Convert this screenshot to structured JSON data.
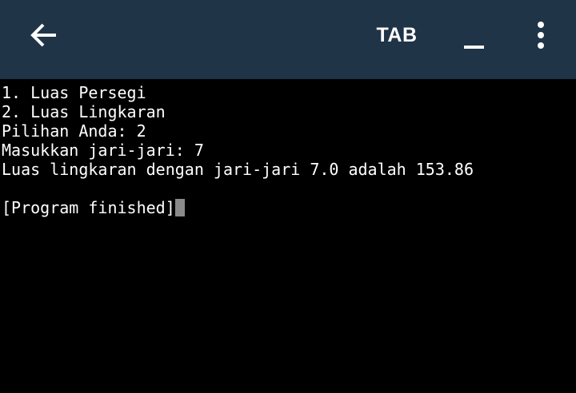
{
  "toolbar": {
    "back_icon": "arrow-left-icon",
    "tab_label": "TAB",
    "minimize_icon": "underscore-icon",
    "menu_icon": "more-vertical-icon",
    "background_color": "#1f3447"
  },
  "terminal": {
    "lines": [
      "1. Luas Persegi",
      "2. Luas Lingkaran",
      "Pilihan Anda: 2",
      "Masukkan jari-jari: 7",
      "Luas lingkaran dengan jari-jari 7.0 adalah 153.86",
      "",
      "[Program finished]"
    ],
    "background_color": "#000000",
    "text_color": "#ffffff",
    "cursor_color": "#8a8a8a"
  }
}
